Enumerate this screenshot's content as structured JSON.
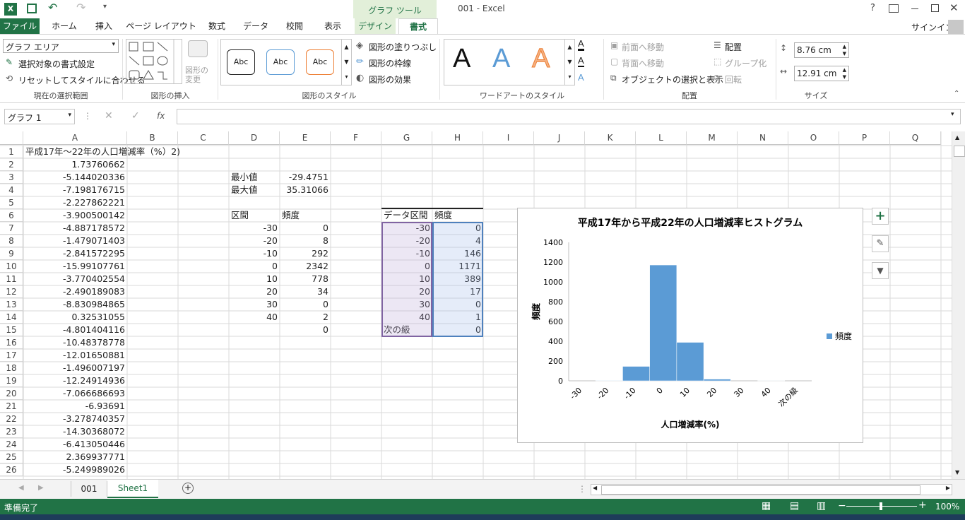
{
  "app": {
    "filename": "001 - Excel",
    "context_tab": "グラフ ツール",
    "help": "?",
    "signin": "サインイン"
  },
  "tabs": [
    "ファイル",
    "ホーム",
    "挿入",
    "ページ レイアウト",
    "数式",
    "データ",
    "校閲",
    "表示",
    "デザイン",
    "書式"
  ],
  "ribbon": {
    "selection_box": "グラフ エリア",
    "format_selection": "選択対象の書式設定",
    "reset_style": "リセットしてスタイルに合わせる",
    "group_current": "現在の選択範囲",
    "change_shape": "図形の変更",
    "group_insert": "図形の挿入",
    "style_abc": "Abc",
    "shape_fill": "図形の塗りつぶし",
    "shape_outline": "図形の枠線",
    "shape_effects": "図形の効果",
    "group_styles": "図形のスタイル",
    "wordart_a": "A",
    "group_wordart": "ワードアートのスタイル",
    "bring_forward": "前面へ移動",
    "send_backward": "背面へ移動",
    "selection_pane": "オブジェクトの選択と表示",
    "align": "配置",
    "group": "グループ化",
    "rotate": "回転",
    "group_arrange": "配置",
    "height": "8.76 cm",
    "width": "12.91 cm",
    "group_size": "サイズ"
  },
  "formula": {
    "namebox": "グラフ 1",
    "fx": "fx"
  },
  "columns": [
    "A",
    "B",
    "C",
    "D",
    "E",
    "F",
    "G",
    "H",
    "I",
    "J",
    "K",
    "L",
    "M",
    "N",
    "O",
    "P",
    "Q"
  ],
  "rows": [
    "1",
    "2",
    "3",
    "4",
    "5",
    "6",
    "7",
    "8",
    "9",
    "10",
    "11",
    "12",
    "13",
    "14",
    "15",
    "16",
    "17",
    "18",
    "19",
    "20",
    "21",
    "22",
    "23",
    "24",
    "25",
    "26"
  ],
  "colA": [
    "平成17年～22年の人口増減率（%）2)",
    "1.73760662",
    "-5.144020336",
    "-7.198176715",
    "-2.227862221",
    "-3.900500142",
    "-4.887178572",
    "-1.479071403",
    "-2.841572295",
    "-15.99107761",
    "-3.770402554",
    "-2.490189083",
    "-8.830984865",
    "0.32531055",
    "-4.801404116",
    "-10.48378778",
    "-12.01650881",
    "-1.496007197",
    "-12.24914936",
    "-7.066686693",
    "-6.93691",
    "-3.278740357",
    "-14.30368072",
    "-6.413050446",
    "2.369937771",
    "-5.249989026"
  ],
  "minmax": {
    "min_label": "最小値",
    "min_val": "-29.4751",
    "max_label": "最大値",
    "max_val": "35.31066"
  },
  "bins_table": {
    "h1": "区間",
    "h2": "頻度",
    "rows": [
      [
        "-30",
        "0"
      ],
      [
        "-20",
        "8"
      ],
      [
        "-10",
        "292"
      ],
      [
        "0",
        "2342"
      ],
      [
        "10",
        "778"
      ],
      [
        "20",
        "34"
      ],
      [
        "30",
        "0"
      ],
      [
        "40",
        "2"
      ],
      [
        "",
        "0"
      ]
    ]
  },
  "hist_table": {
    "h1": "データ区間",
    "h2": "頻度",
    "rows": [
      [
        "-30",
        "0"
      ],
      [
        "-20",
        "4"
      ],
      [
        "-10",
        "146"
      ],
      [
        "0",
        "1171"
      ],
      [
        "10",
        "389"
      ],
      [
        "20",
        "17"
      ],
      [
        "30",
        "0"
      ],
      [
        "40",
        "1"
      ],
      [
        "次の級",
        "0"
      ]
    ]
  },
  "chart_data": {
    "type": "bar",
    "title": "平成17年から平成22年の人口増減率ヒストグラム",
    "xlabel": "人口増減率(%)",
    "ylabel": "頻度",
    "categories": [
      "-30",
      "-20",
      "-10",
      "0",
      "10",
      "20",
      "30",
      "40",
      "次の級"
    ],
    "series": [
      {
        "name": "頻度",
        "values": [
          0,
          4,
          146,
          1171,
          389,
          17,
          0,
          1,
          0
        ],
        "color": "#5b9bd5"
      }
    ],
    "ylim": [
      0,
      1400
    ],
    "yticks": [
      "0",
      "200",
      "400",
      "600",
      "800",
      "1000",
      "1200",
      "1400"
    ],
    "legend": "right",
    "grid": false
  },
  "sheettabs": {
    "tab1": "001",
    "tab2": "Sheet1",
    "add": "+"
  },
  "status": {
    "ready": "準備完了",
    "zoom": "100%"
  },
  "colors": {
    "excel_green": "#217346",
    "accent": "#217346",
    "bar": "#5b9bd5"
  }
}
